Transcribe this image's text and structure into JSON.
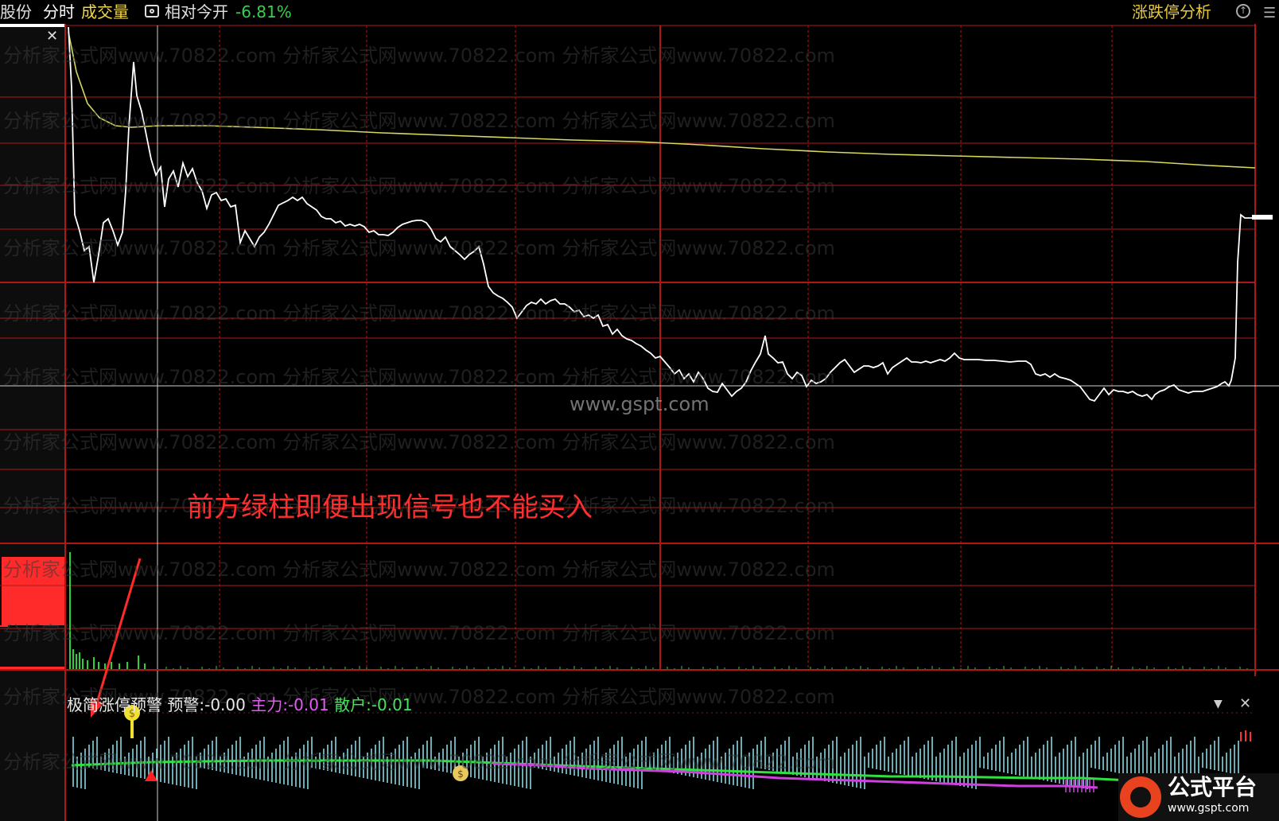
{
  "toolbar": {
    "left_fragment": "股份",
    "fenshi": "分时",
    "volume": "成交量",
    "camera_icon": "camera-icon",
    "relative_label": "相对今开",
    "relative_value": "-6.81%",
    "limit_analysis": "涨跌停分析"
  },
  "indicator": {
    "name": "极简涨停预警",
    "alert_label": "预警:",
    "alert_value": "-0.00",
    "main_label": "主力:",
    "main_value": "-0.01",
    "retail_label": "散户:",
    "retail_value": "-0.01"
  },
  "annotation": "前方绿柱即便出现信号也不能买入",
  "watermarks": {
    "center": "www.gspt.com",
    "tile": "分析家公式网www.70822.com  分析家公式网www.70822.com  分析家公式网www.70822.com"
  },
  "logo": {
    "name": "公式平台",
    "url": "www.gspt.com"
  },
  "colors": {
    "grid": "#b01818",
    "price_line": "#ffffff",
    "avg_line": "#d8d860",
    "volume_bar": "#2fd13a",
    "cyan_bar": "#8fe6f0",
    "main_line": "#30e040",
    "retail_line": "#d040e0",
    "annotation": "#ff2e2e"
  }
}
